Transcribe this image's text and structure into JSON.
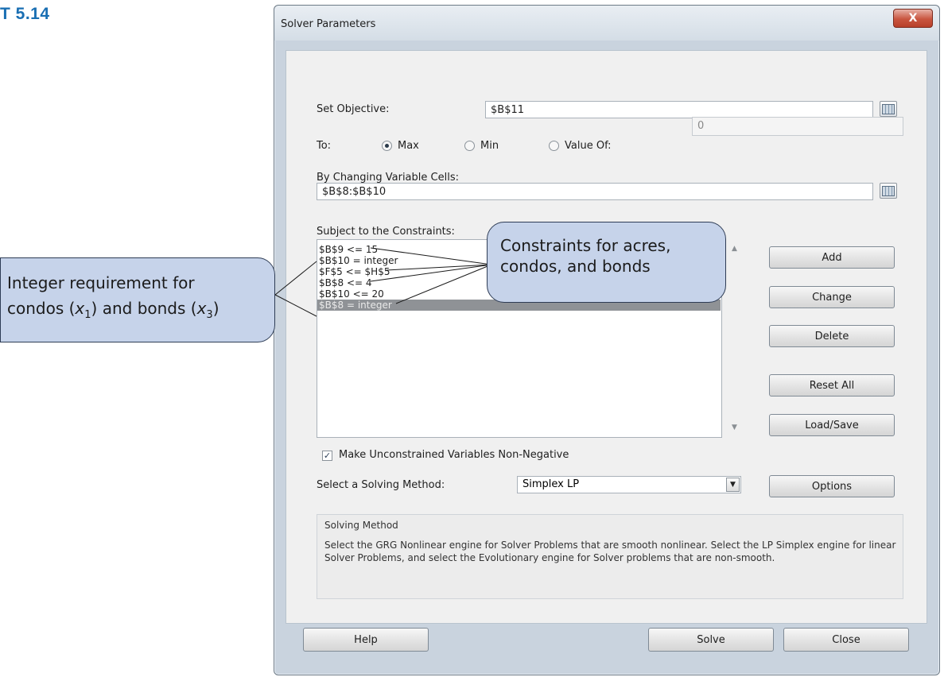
{
  "exhibit_label": "T 5.14",
  "dialog": {
    "title": "Solver Parameters",
    "close_label": "X",
    "set_objective_label": "Set Objective:",
    "objective_value": "$B$11",
    "to_label": "To:",
    "radio_max": "Max",
    "radio_min": "Min",
    "radio_value_of": "Value Of:",
    "value_of_value": "0",
    "selected_goal": "Max",
    "changing_cells_label": "By Changing Variable Cells:",
    "changing_cells_value": "$B$8:$B$10",
    "constraints_label": "Subject to the Constraints:",
    "constraints": [
      "$B$9 <= 15",
      "$B$10 = integer",
      "$F$5 <= $H$5",
      "$B$8 <= 4",
      "$B$10 <= 20",
      "$B$8 = integer"
    ],
    "selected_constraint": "$B$8 = integer",
    "buttons": {
      "add": "Add",
      "change": "Change",
      "delete": "Delete",
      "reset_all": "Reset All",
      "load_save": "Load/Save",
      "options": "Options",
      "help": "Help",
      "solve": "Solve",
      "close": "Close"
    },
    "non_negative_label": "Make Unconstrained Variables Non-Negative",
    "non_negative_checked": true,
    "solving_method_label": "Select a Solving Method:",
    "solving_method_value": "Simplex LP",
    "solving_method_group_title": "Solving Method",
    "solving_method_description": "Select the GRG Nonlinear engine for Solver Problems that are smooth nonlinear. Select the LP Simplex engine for linear Solver Problems, and select the Evolutionary engine for Solver problems that are non-smooth."
  },
  "callouts": {
    "constraints_callout": "Constraints for acres, condos, and bonds",
    "integer_callout_line1": "Integer requirement for",
    "integer_callout_line2_a": "condos (",
    "integer_callout_var1": "x",
    "integer_callout_sub1": "1",
    "integer_callout_line2_b": ") and bonds (",
    "integer_callout_var3": "x",
    "integer_callout_sub3": "3",
    "integer_callout_line2_c": ")"
  },
  "colors": {
    "callout_fill": "#c6d3ea",
    "selection_gray": "#8f9296",
    "exhibit_blue": "#1a6fb3"
  }
}
